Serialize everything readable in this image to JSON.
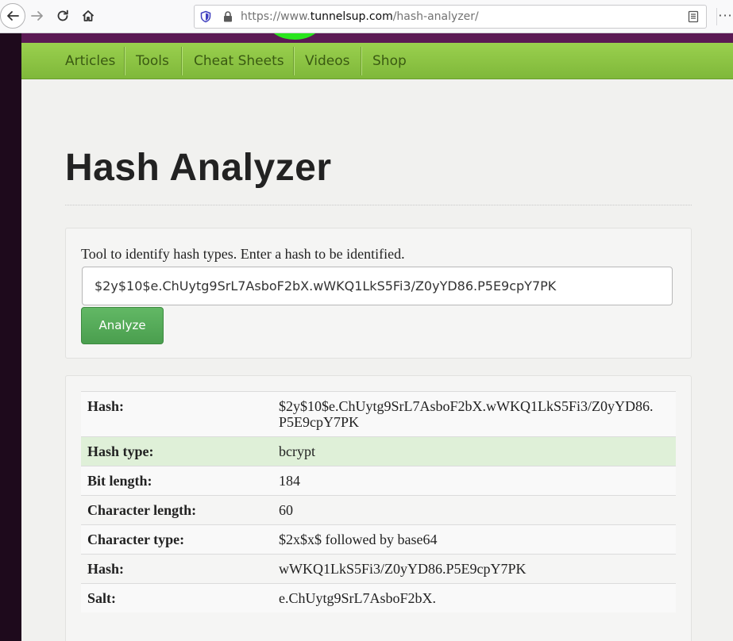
{
  "browser": {
    "url_prefix": "https://www.",
    "url_domain": "tunnelsup.com",
    "url_path": "/hash-analyzer/",
    "menu_glyph": "···"
  },
  "nav": {
    "items": [
      "Articles",
      "Tools",
      "Cheat Sheets",
      "Videos",
      "Shop"
    ]
  },
  "page": {
    "title": "Hash Analyzer"
  },
  "form": {
    "description": "Tool to identify hash types. Enter a hash to be identified.",
    "hash_value": "$2y$10$e.ChUytg9SrL7AsboF2bX.wWKQ1LkS5Fi3/Z0yYD86.P5E9cpY7PK",
    "analyze_label": "Analyze"
  },
  "results": [
    {
      "label": "Hash:",
      "value": "$2y$10$e.ChUytg9SrL7AsboF2bX.wWKQ1LkS5Fi3/Z0yYD86.P5E9cpY7PK"
    },
    {
      "label": "Hash type:",
      "value": "bcrypt"
    },
    {
      "label": "Bit length:",
      "value": "184"
    },
    {
      "label": "Character length:",
      "value": "60"
    },
    {
      "label": "Character type:",
      "value": "$2x$x$ followed by base64"
    },
    {
      "label": "Hash:",
      "value": "wWKQ1LkS5Fi3/Z0yYD86.P5E9cpY7PK"
    },
    {
      "label": "Salt:",
      "value": "e.ChUytg9SrL7AsboF2bX."
    }
  ],
  "colors": {
    "nav_green": "#8bc34a",
    "header_purple": "#5b1a54",
    "highlight_row": "#dff0d8",
    "analyze_button": "#4caf50"
  }
}
